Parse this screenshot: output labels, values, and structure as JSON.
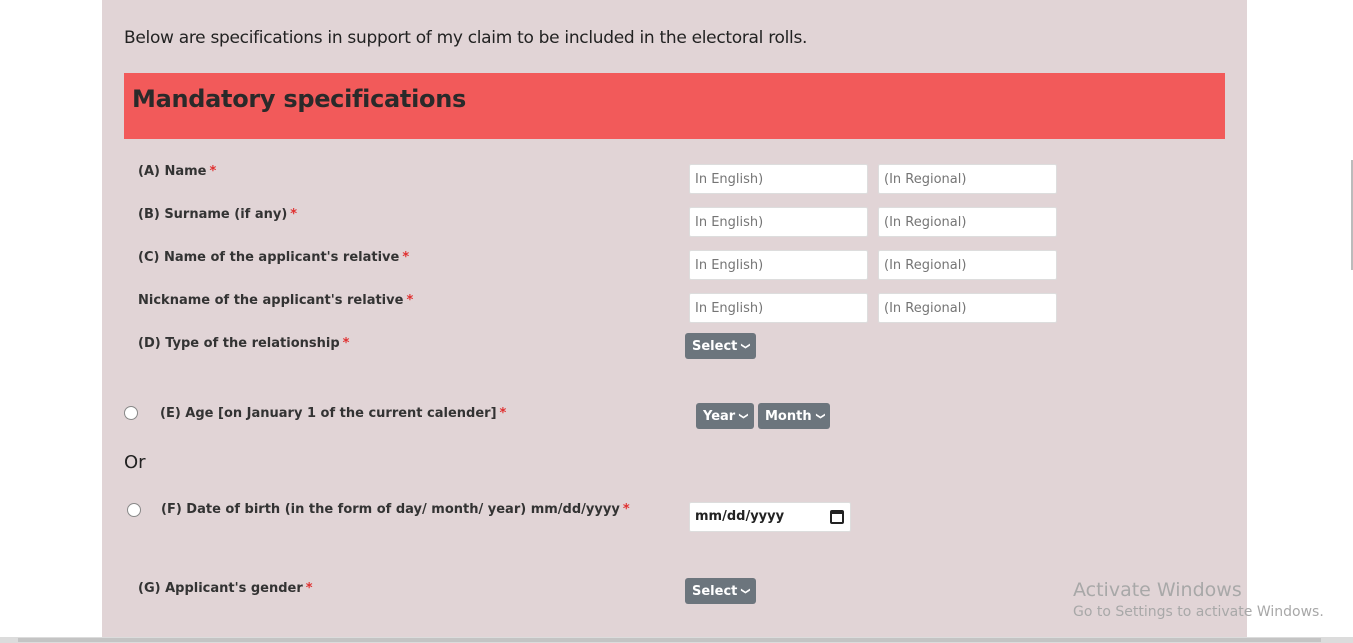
{
  "intro_text": "Below are specifications in support of my claim to be included in the electoral rolls.",
  "section_title": "Mandatory specifications",
  "required_mark": "*",
  "fields": {
    "name_label": "(A) Name",
    "surname_label": "(B) Surname (if any)",
    "relative_name_label": "(C) Name of the applicant's relative",
    "relative_nickname_label": "Nickname of the applicant's relative",
    "relationship_label": "(D) Type of the relationship",
    "age_label": "(E) Age [on January 1 of the current calender]",
    "dob_label": "(F) Date of birth (in the form of day/ month/ year) mm/dd/yyyy",
    "gender_label": "(G) Applicant's gender"
  },
  "placeholders": {
    "english": "In English)",
    "regional": "(In Regional)"
  },
  "selects": {
    "relationship": "Select",
    "year": "Year",
    "month": "Month",
    "gender": "Select"
  },
  "or_text": "Or",
  "date_value": "mm/dd/yyyy",
  "watermark": {
    "line1": "Activate Windows",
    "line2": "Go to Settings to activate Windows."
  },
  "colors": {
    "banner": "#f25a5a",
    "panel": "#e1d4d6",
    "select_bg": "#6c757d",
    "required": "#e03030"
  }
}
